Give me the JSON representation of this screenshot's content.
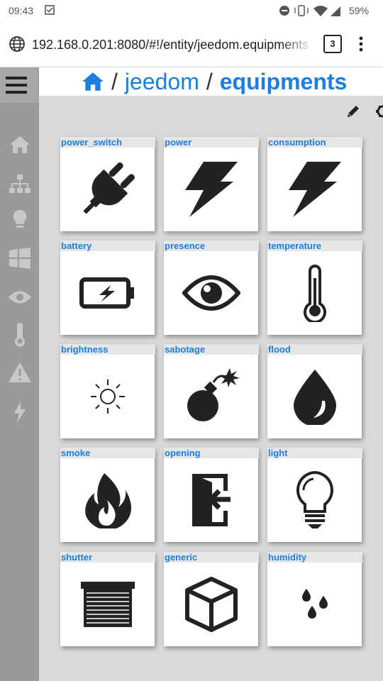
{
  "status_bar": {
    "time": "09:43",
    "battery_percent": "59%"
  },
  "browser": {
    "url": "192.168.0.201:8080/#!/entity/jeedom.equipments",
    "tab_count": "3"
  },
  "breadcrumb": {
    "home": "home-icon",
    "sep1": "/",
    "level1": "jeedom",
    "sep2": "/",
    "level2": "equipments"
  },
  "tiles": [
    {
      "label": "power_switch",
      "icon": "plug-icon"
    },
    {
      "label": "power",
      "icon": "bolt-icon"
    },
    {
      "label": "consumption",
      "icon": "bolt-icon"
    },
    {
      "label": "battery",
      "icon": "battery-charging-icon"
    },
    {
      "label": "presence",
      "icon": "eye-icon"
    },
    {
      "label": "temperature",
      "icon": "thermometer-icon"
    },
    {
      "label": "brightness",
      "icon": "sun-icon"
    },
    {
      "label": "sabotage",
      "icon": "bomb-icon"
    },
    {
      "label": "flood",
      "icon": "water-drop-icon"
    },
    {
      "label": "smoke",
      "icon": "fire-icon"
    },
    {
      "label": "opening",
      "icon": "door-entry-icon"
    },
    {
      "label": "light",
      "icon": "lightbulb-icon"
    },
    {
      "label": "shutter",
      "icon": "shutter-icon"
    },
    {
      "label": "generic",
      "icon": "cube-icon"
    },
    {
      "label": "humidity",
      "icon": "drops-icon"
    }
  ]
}
